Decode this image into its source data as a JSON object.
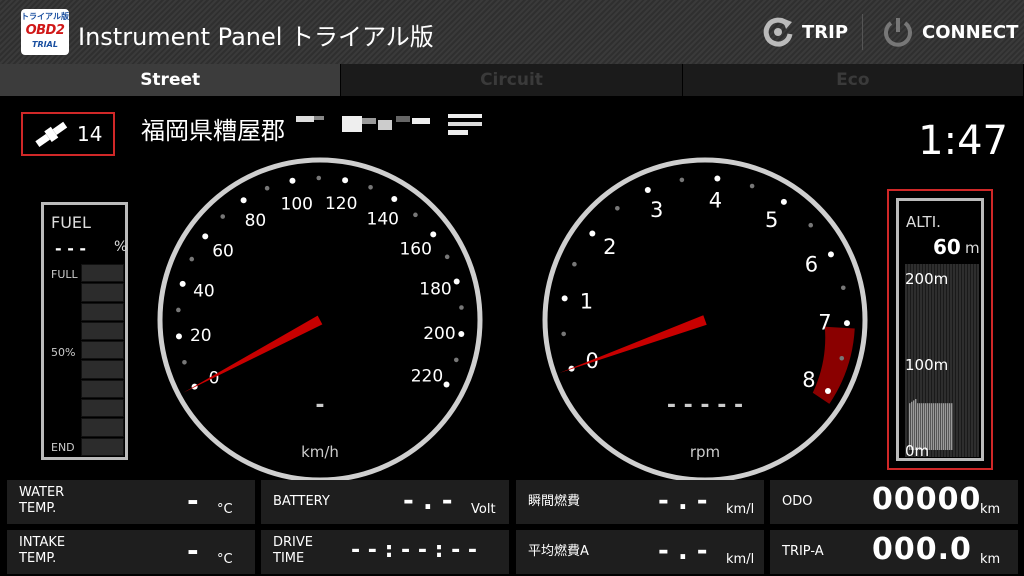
{
  "app": {
    "icon_line1": "トライアル版",
    "icon_line2": "OBD2",
    "icon_line3": "TRIAL",
    "title": "Instrument Panel トライアル版"
  },
  "actions": {
    "trip_label": "TRIP",
    "connect_label": "CONNECT"
  },
  "tabs": [
    {
      "label": "Street",
      "active": true
    },
    {
      "label": "Circuit",
      "active": false
    },
    {
      "label": "Eco",
      "active": false
    }
  ],
  "gps": {
    "satellites": "14",
    "location": "福岡県糟屋郡"
  },
  "clock": "1:47",
  "fuel": {
    "title": "FUEL",
    "value": "- - -",
    "unit": "%",
    "full_label": "FULL",
    "half_label": "50%",
    "end_label": "END",
    "level_percent": 0
  },
  "speedometer": {
    "ticks": [
      "0",
      "20",
      "40",
      "60",
      "80",
      "100",
      "120",
      "140",
      "160",
      "180",
      "200",
      "220"
    ],
    "digital_value": "-",
    "unit": "km/h",
    "needle_value": 0
  },
  "tachometer": {
    "ticks": [
      "0",
      "1",
      "2",
      "3",
      "4",
      "5",
      "6",
      "7",
      "8"
    ],
    "digital_value": "- - - - -",
    "unit": "rpm",
    "needle_value": 0,
    "redline_start": 7
  },
  "altimeter": {
    "title": "ALTI.",
    "value": "60",
    "unit": "m",
    "levels": [
      "200m",
      "100m",
      "0m"
    ],
    "current_altitude_m": 60
  },
  "info": {
    "water_temp": {
      "name_line1": "WATER",
      "name_line2": "TEMP.",
      "value": "-",
      "unit": "°C"
    },
    "intake_temp": {
      "name_line1": "INTAKE",
      "name_line2": "TEMP.",
      "value": "-",
      "unit": "°C"
    },
    "battery": {
      "name": "BATTERY",
      "value": "- . -",
      "unit": "Volt"
    },
    "drive_time": {
      "name_line1": "DRIVE",
      "name_line2": "TIME",
      "value": "- - : - - : - -"
    },
    "instant_fuel": {
      "name": "瞬間燃費",
      "value": "- . -",
      "unit": "km/l"
    },
    "avg_fuel": {
      "name": "平均燃費A",
      "value": "- . -",
      "unit": "km/l"
    },
    "odo": {
      "name": "ODO",
      "value": "00000",
      "unit": "km"
    },
    "trip_a": {
      "name": "TRIP-A",
      "value": "000.0",
      "unit": "km"
    }
  }
}
